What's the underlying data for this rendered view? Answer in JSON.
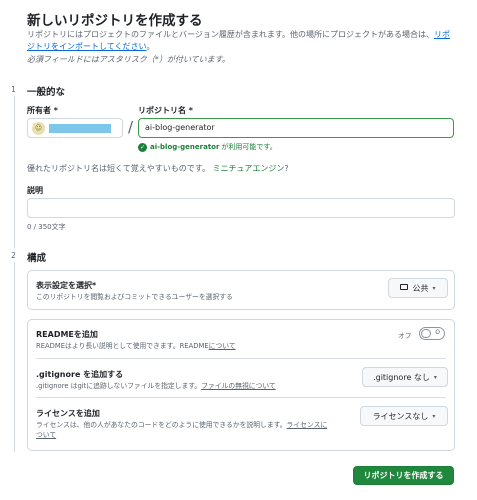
{
  "header": {
    "title": "新しいリポジトリを作成する",
    "description": "リポジトリにはプロジェクトのファイルとバージョン履歴が含まれます。他の場所にプロジェクトがある場合は、",
    "import_link": "リポジトリをインポートしてください",
    "description_end": "。",
    "required_note": "必須フィールドにはアスタリスク（*）が付いています。"
  },
  "section1": {
    "step": "1",
    "title": "一般的な",
    "owner_label": "所有者 *",
    "repo_label": "リポジトリ名 *",
    "repo_value": "ai-blog-generator",
    "availability_name": "ai-blog-generator",
    "availability_suffix": "が利用可能です。",
    "hint_text": "優れたリポジトリ名は短くて覚えやすいものです。",
    "hint_suggestion": "ミニチュアエンジン",
    "hint_end": "?",
    "description_label": "説明",
    "description_value": "",
    "description_counter": "0 / 350文字"
  },
  "section2": {
    "step": "2",
    "title": "構成",
    "visibility": {
      "title": "表示設定を選択*",
      "subtitle": "このリポジトリを閲覧およびコミットできるユーザーを選択する",
      "value": "公共"
    },
    "readme": {
      "title": "READMEを追加",
      "subtitle": "READMEはより長い説明として使用できます。README",
      "subtitle_link": "について",
      "toggle_state_label": "オフ",
      "toggle_glyph": "O",
      "enabled": false
    },
    "gitignore": {
      "title": ".gitignore を追加する",
      "subtitle": ".gitignore はgitに追跡しないファイルを指定します。",
      "subtitle_link": "ファイルの無視について",
      "value": ".gitignore なし"
    },
    "license": {
      "title": "ライセンスを追加",
      "subtitle": "ライセンスは、他の人があなたのコードをどのように使用できるかを説明します。",
      "subtitle_link_1": "ライセンスに",
      "subtitle_link_2": "ついて",
      "value": "ライセンスなし"
    }
  },
  "footer": {
    "create_label": "リポジトリを作成する"
  },
  "icons": {
    "caret": "▾",
    "check": "✓",
    "avatar": "☺"
  },
  "colors": {
    "primary_green": "#1f883d",
    "link_blue": "#0969da",
    "success_green": "#1a7f37"
  }
}
